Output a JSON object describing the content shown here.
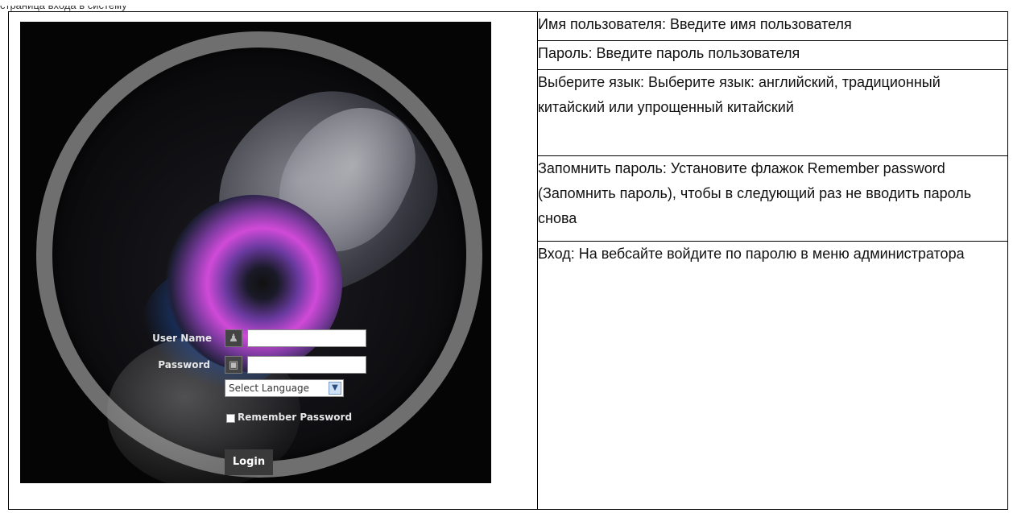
{
  "top_caption": "страница входа в систему",
  "login_screen": {
    "username_label": "User Name",
    "password_label": "Password",
    "language_select": "Select Language",
    "remember_label": "Remember Password",
    "login_button": "Login",
    "icons": [
      "user-icon",
      "lock-icon",
      "chevron-down-icon"
    ]
  },
  "descriptions": [
    "Имя пользователя: Введите имя пользователя",
    "Пароль: Введите пароль пользователя",
    "Выберите язык: Выберите язык: английский, традиционный китайский или упрощенный китайский",
    "Запомнить пароль: Установите флажок Remember password (Запомнить пароль), чтобы в следующий раз не вводить пароль снова",
    "Вход: На вебсайте войдите по паролю в меню администратора"
  ]
}
